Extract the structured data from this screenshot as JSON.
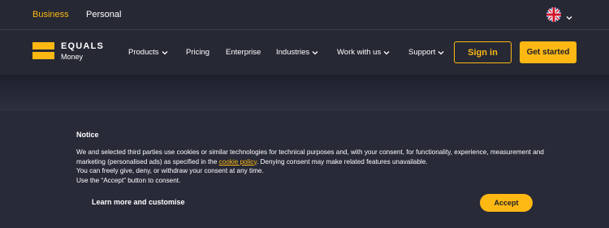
{
  "topbar": {
    "business_label": "Business",
    "personal_label": "Personal",
    "language_icon": "uk-flag-icon"
  },
  "navbar": {
    "logo_word1": "EQUALS",
    "logo_word2": "Money",
    "items": [
      {
        "label": "Products",
        "has_dropdown": true
      },
      {
        "label": "Pricing",
        "has_dropdown": false
      },
      {
        "label": "Enterprise",
        "has_dropdown": false
      },
      {
        "label": "Industries",
        "has_dropdown": true
      },
      {
        "label": "Work with us",
        "has_dropdown": true
      },
      {
        "label": "Support",
        "has_dropdown": true
      }
    ],
    "signin_label": "Sign in",
    "getstarted_label": "Get started"
  },
  "consent": {
    "title": "Notice",
    "text_part1": "We and selected third parties use cookies or similar technologies for technical purposes and, with your consent, for functionality, experience, measurement and marketing (personalised ads) as specified in the ",
    "link_text": "cookie policy",
    "text_part2": ". Denying consent may make related features unavailable.",
    "line2": "You can freely give, deny, or withdraw your consent at any time.",
    "line3": "Use the “Accept” button to consent.",
    "learn_more_label": "Learn more and customise",
    "accept_label": "Accept"
  },
  "colors": {
    "accent": "#fdb813",
    "background": "#282a38",
    "nav_background": "#262834"
  }
}
